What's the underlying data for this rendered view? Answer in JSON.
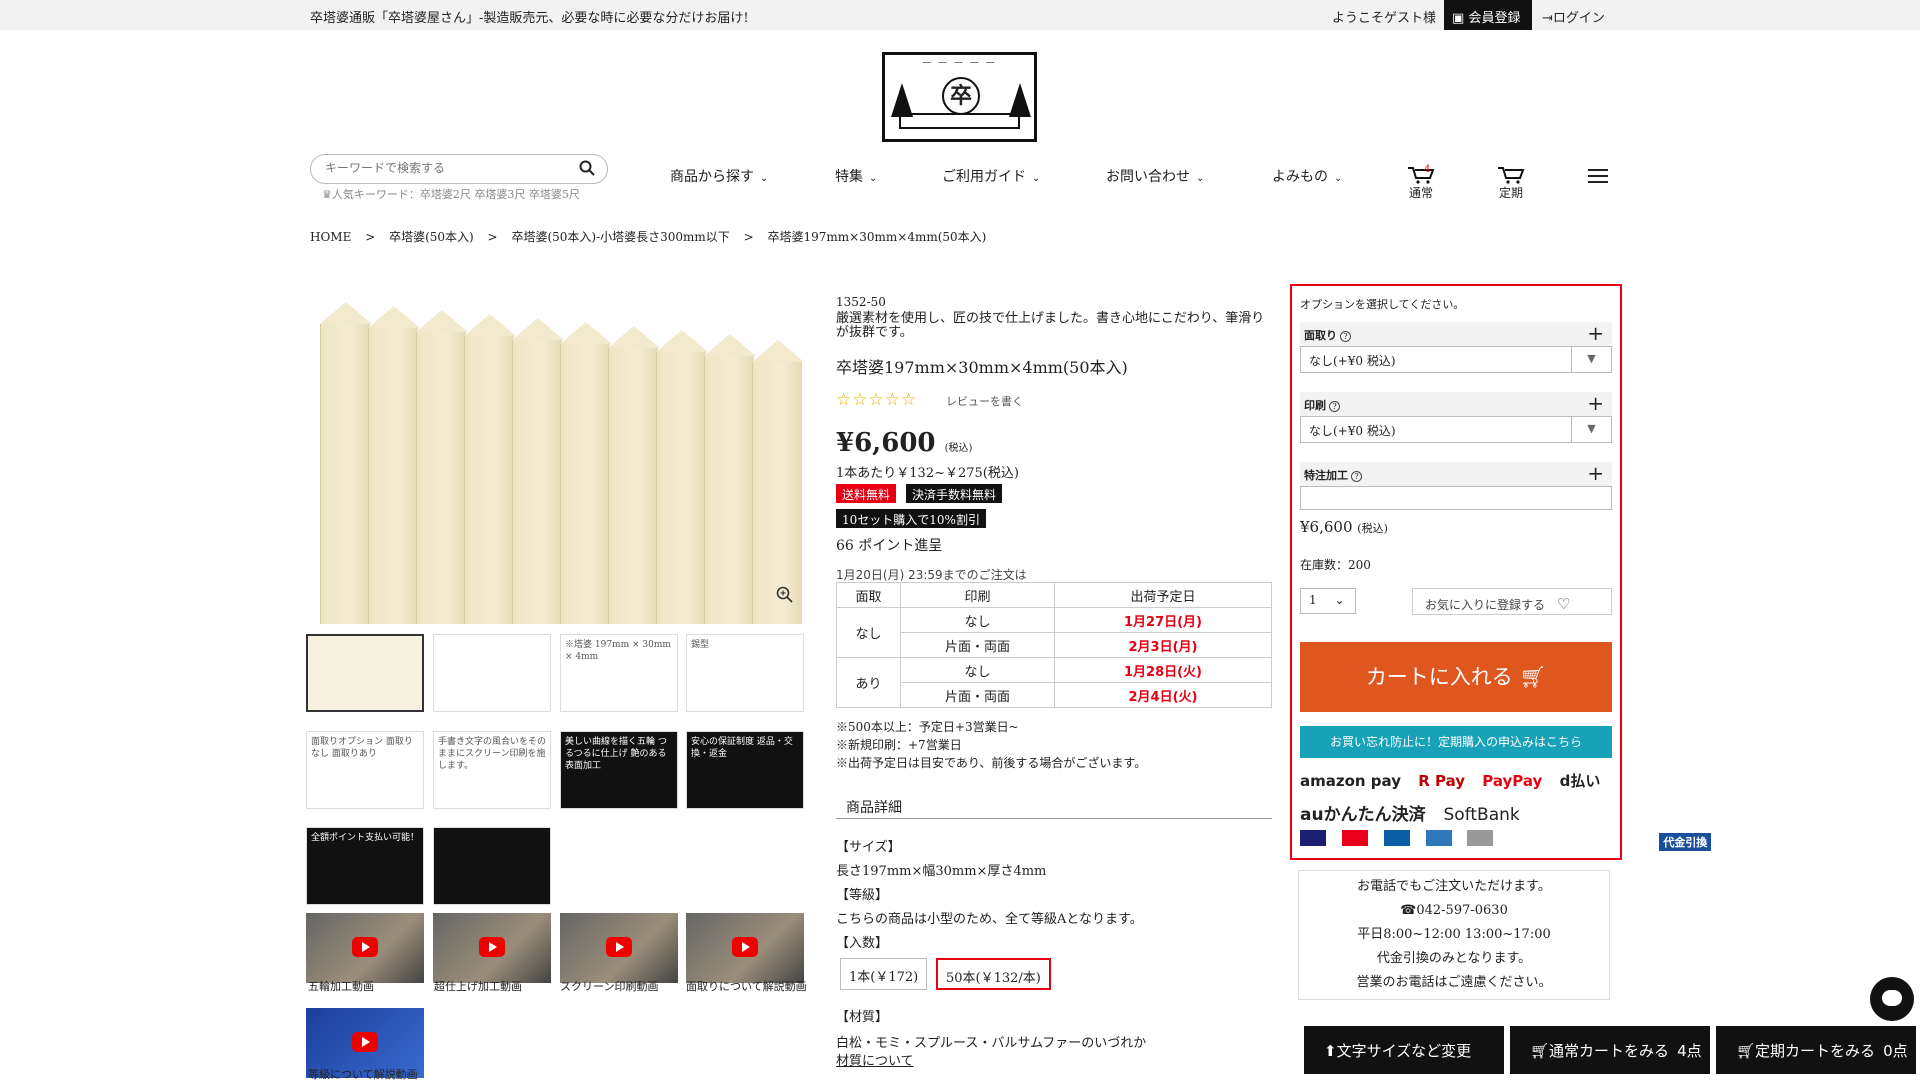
{
  "topbar": {
    "notice": "卒塔婆通販「卒塔婆屋さん」-製造販売元、必要な時に必要な分だけお届け!",
    "welcome": "ようこそゲスト様",
    "register": "会員登録",
    "login": "ログイン"
  },
  "search": {
    "placeholder": "キーワードで検索する",
    "popular": "人気キーワード：卒塔婆2尺 卒塔婆3尺 卒塔婆5尺"
  },
  "nav": [
    "商品から探す",
    "特集",
    "ご利用ガイド",
    "お問い合わせ",
    "よみもの"
  ],
  "carts": {
    "normal_label": "通常",
    "normal_count": "4",
    "subscription_label": "定期"
  },
  "breadcrumb": [
    "HOME",
    ">",
    "卒塔婆(50本入)",
    ">",
    "卒塔婆(50本入)-小塔婆長さ300mm以下",
    ">",
    "卒塔婆197mm×30mm×4mm(50本入)"
  ],
  "product": {
    "code": "1352-50",
    "description": "厳選素材を使用し、匠の技で仕上げました。書き心地にこだわり、筆滑りが抜群です。",
    "title": "卒塔婆197mm×30mm×4mm(50本入)",
    "rating": 0,
    "review_link": "レビューを書く",
    "price": "¥6,600",
    "price_tax": "(税込)",
    "unit_price": "1本あたり￥132~￥275(税込)",
    "tags": [
      "送料無料",
      "決済手数料無料",
      "10セット購入で10%割引"
    ],
    "points": "66 ポイント進呈",
    "deadline": "1月20日(月) 23:59までのご注文は"
  },
  "shipping": {
    "headers": [
      "面取",
      "印刷",
      "出荷予定日"
    ],
    "groups": [
      {
        "chamfer": "なし",
        "rows": [
          {
            "print": "なし",
            "date": "1月27日(月)"
          },
          {
            "print": "片面・両面",
            "date": "2月3日(月)"
          }
        ]
      },
      {
        "chamfer": "あり",
        "rows": [
          {
            "print": "なし",
            "date": "1月28日(火)"
          },
          {
            "print": "片面・両面",
            "date": "2月4日(火)"
          }
        ]
      }
    ]
  },
  "notes": [
    "※500本以上：予定日+3営業日~",
    "※新規印刷：+7営業日",
    "※出荷予定日は目安であり、前後する場合がございます。"
  ],
  "details": {
    "heading": "商品詳細",
    "size_label": "【サイズ】",
    "size_value": "長さ197mm×幅30mm×厚さ4mm",
    "grade_label": "【等級】",
    "grade_value": "こちらの商品は小型のため、全て等級Aとなります。",
    "count_label": "【入数】",
    "count_options": [
      "1本(￥172)",
      "50本(￥132/本)"
    ],
    "material_label": "【材質】",
    "material_value": "白松・モミ・スプルース・バルサムファーのいづれか",
    "material_link": "材質について"
  },
  "gallery": {
    "thumb_captions": [
      "",
      "",
      "※塔婆 197mm × 30mm × 4mm",
      "錫型",
      "面取りオプション 面取りなし 面取りあり",
      "手書き文字の風合いをそのままにスクリーン印刷を施します。",
      "美しい曲線を描く五輪 つるつるに仕上げ 艶のある表面加工",
      "安心の保証制度 返品・交換・返金",
      "全額ポイント支払い可能！",
      "",
      "五輪加工動画",
      "超仕上げ加工動画",
      "スクリーン印刷動画",
      "面取りについて解説動画",
      "等級について解説動画"
    ]
  },
  "options": {
    "hint": "オプションを選択してください。",
    "chamfer_label": "面取り",
    "chamfer_value": "なし(+¥0 税込)",
    "print_label": "印刷",
    "print_value": "なし(+¥0 税込)",
    "custom_label": "特注加工",
    "price": "¥6,600",
    "price_tax": "(税込)",
    "stock": "在庫数：200",
    "qty": "1",
    "favorite": "お気に入りに登録する",
    "cart_button": "カートに入れる",
    "subscription_button": "お買い忘れ防止に！定期購入の申込みはこちら",
    "payments": [
      "amazon pay",
      "R Pay",
      "PayPay",
      "d払い",
      "auかんたん決済",
      "SoftBank",
      "代金引換"
    ]
  },
  "phone": {
    "line1": "お電話でもご注文いただけます。",
    "number": "042-597-0630",
    "hours": "平日8:00~12:00 13:00~17:00",
    "line3": "代金引換のみとなります。",
    "line4": "営業のお電話はご遠慮ください。"
  },
  "bottombar": {
    "font": "文字サイズなど変更",
    "normal_cart": "通常カートをみる",
    "normal_count": "4点",
    "sub_cart": "定期カートをみる",
    "sub_count": "0点"
  },
  "colors": {
    "accent_red": "#e60012",
    "cart_orange": "#e0561f",
    "teal": "#17a2b8"
  }
}
